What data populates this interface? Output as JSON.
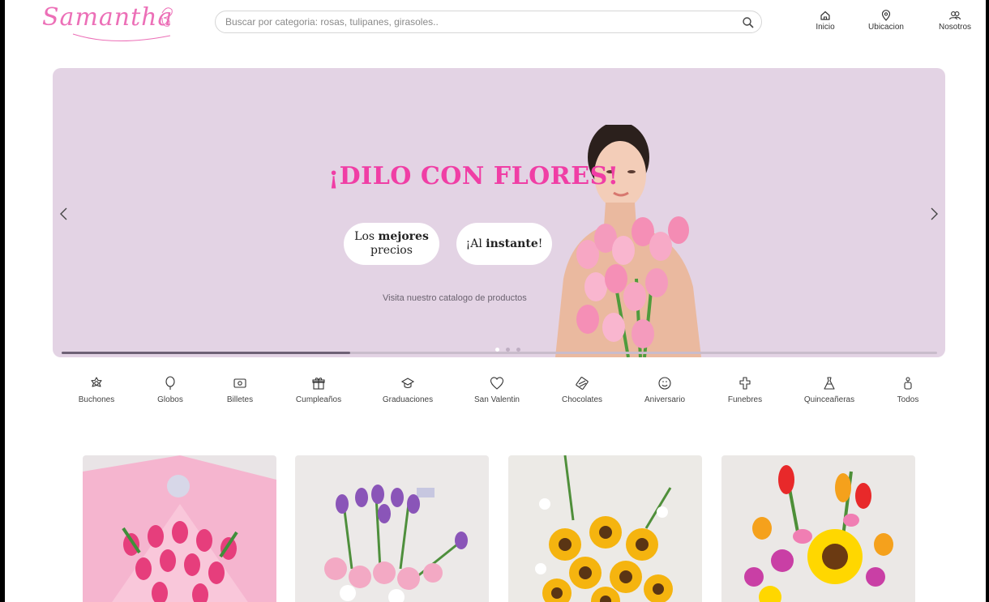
{
  "header": {
    "logo_text": "Samantha",
    "search": {
      "placeholder": "Buscar por categoria: rosas, tulipanes, girasoles.."
    },
    "nav": [
      {
        "label": "Inicio",
        "icon": "home-icon"
      },
      {
        "label": "Ubicacion",
        "icon": "location-pin-icon"
      },
      {
        "label": "Nosotros",
        "icon": "users-icon"
      }
    ]
  },
  "banner": {
    "title": "¡DILO CON FLORES!",
    "pill_1": {
      "pre": "Los ",
      "bold": "mejores",
      "post": "precios"
    },
    "pill_2": {
      "pre": "¡Al ",
      "bold": "instante",
      "post": "!"
    },
    "cta": "Visita nuestro catalogo de productos",
    "slide_count": 3,
    "active_slide": 0,
    "progress": 0.33
  },
  "categories": [
    {
      "label": "Buchones",
      "icon": "flower-icon"
    },
    {
      "label": "Globos",
      "icon": "balloon-icon"
    },
    {
      "label": "Billetes",
      "icon": "banknote-icon"
    },
    {
      "label": "Cumpleaños",
      "icon": "gift-icon"
    },
    {
      "label": "Graduaciones",
      "icon": "graduation-cap-icon"
    },
    {
      "label": "San Valentin",
      "icon": "heart-icon"
    },
    {
      "label": "Chocolates",
      "icon": "chocolate-icon"
    },
    {
      "label": "Aniversario",
      "icon": "anniversary-icon"
    },
    {
      "label": "Funebres",
      "icon": "cross-icon"
    },
    {
      "label": "Quinceañeras",
      "icon": "dress-icon"
    },
    {
      "label": "Todos",
      "icon": "all-categories-icon"
    }
  ],
  "colors": {
    "brand_pink": "#f03ea5",
    "logo_pink": "#ec6fb7",
    "banner_bg": "#e3d3e4"
  }
}
